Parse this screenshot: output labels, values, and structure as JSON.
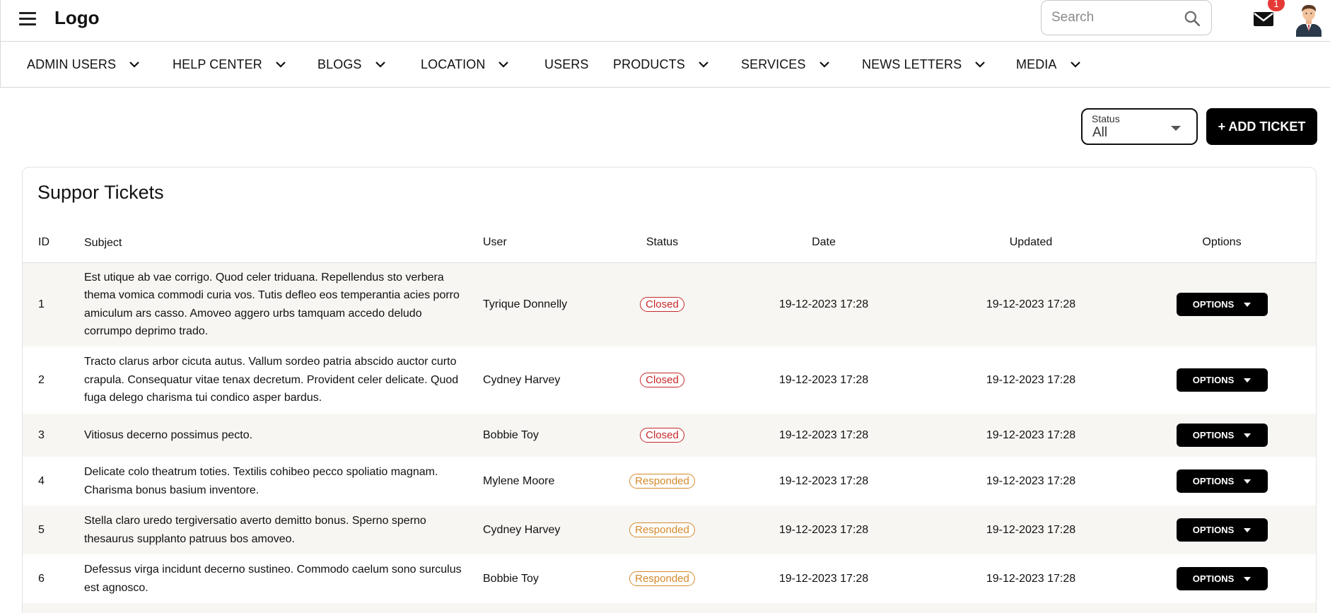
{
  "header": {
    "logo": "Logo",
    "search_placeholder": "Search",
    "notification_count": "1",
    "icons": {
      "menu": "hamburger-menu-icon",
      "search": "search-icon",
      "mail": "mail-icon",
      "avatar": "user-avatar"
    }
  },
  "nav": {
    "items": [
      {
        "label": "ADMIN USERS",
        "has_dropdown": true
      },
      {
        "label": "HELP CENTER",
        "has_dropdown": true
      },
      {
        "label": "BLOGS",
        "has_dropdown": true
      },
      {
        "label": "LOCATION",
        "has_dropdown": true
      },
      {
        "label": "USERS",
        "has_dropdown": false
      },
      {
        "label": "PRODUCTS",
        "has_dropdown": true
      },
      {
        "label": "SERVICES",
        "has_dropdown": true
      },
      {
        "label": "NEWS LETTERS",
        "has_dropdown": true
      },
      {
        "label": "MEDIA",
        "has_dropdown": true
      }
    ]
  },
  "controls": {
    "status_label": "Status",
    "status_value": "All",
    "add_ticket_label": "+ ADD TICKET"
  },
  "tickets": {
    "title": "Suppor Tickets",
    "columns": [
      "ID",
      "Subject",
      "User",
      "Status",
      "Date",
      "Updated",
      "Options"
    ],
    "rows": [
      {
        "id": "1",
        "subject": "Est utique ab vae corrigo. Quod celer triduana. Repellendus sto verbera thema vomica commodi curia vos. Tutis defleo eos temperantia acies porro amiculum ars casso. Amoveo aggero urbs tamquam accedo deludo corrumpo deprimo trado.",
        "user": "Tyrique Donnelly",
        "status": "Closed",
        "date": "19-12-2023 17:28",
        "updated": "19-12-2023 17:28",
        "options": "OPTIONS"
      },
      {
        "id": "2",
        "subject": "Tracto clarus arbor cicuta autus. Vallum sordeo patria abscido auctor curto crapula. Consequatur vitae tenax decretum. Provident celer delicate. Quod fuga delego charisma tui condico asper bardus.",
        "user": "Cydney Harvey",
        "status": "Closed",
        "date": "19-12-2023 17:28",
        "updated": "19-12-2023 17:28",
        "options": "OPTIONS"
      },
      {
        "id": "3",
        "subject": "Vitiosus decerno possimus pecto.",
        "user": "Bobbie Toy",
        "status": "Closed",
        "date": "19-12-2023 17:28",
        "updated": "19-12-2023 17:28",
        "options": "OPTIONS"
      },
      {
        "id": "4",
        "subject": "Delicate colo theatrum toties. Textilis cohibeo pecco spoliatio magnam. Charisma bonus basium inventore.",
        "user": "Mylene Moore",
        "status": "Responded",
        "date": "19-12-2023 17:28",
        "updated": "19-12-2023 17:28",
        "options": "OPTIONS"
      },
      {
        "id": "5",
        "subject": "Stella claro uredo tergiversatio averto demitto bonus. Sperno sperno thesaurus supplanto patruus bos amoveo.",
        "user": "Cydney Harvey",
        "status": "Responded",
        "date": "19-12-2023 17:28",
        "updated": "19-12-2023 17:28",
        "options": "OPTIONS"
      },
      {
        "id": "6",
        "subject": "Defessus virga incidunt decerno sustineo. Commodo caelum sono surculus est agnosco.",
        "user": "Bobbie Toy",
        "status": "Responded",
        "date": "19-12-2023 17:28",
        "updated": "19-12-2023 17:28",
        "options": "OPTIONS"
      }
    ]
  },
  "colors": {
    "closed": "#c62828",
    "responded": "#d4892a",
    "primary_button": "#000000",
    "row_stripe": "#f7f6f3",
    "badge": "#e53935"
  }
}
